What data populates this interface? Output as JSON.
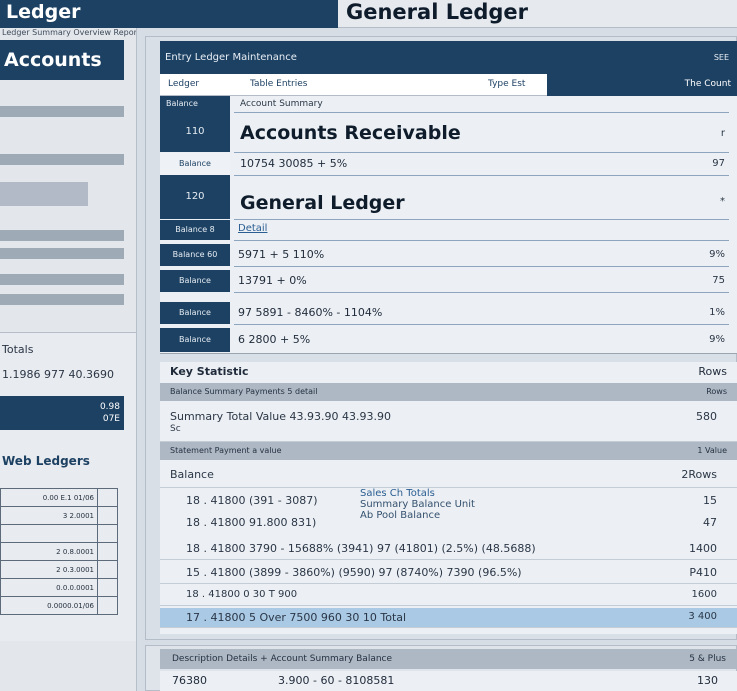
{
  "topbar": {
    "left_title": "Ledger",
    "right_title": "General Ledger"
  },
  "sidebar": {
    "caption": "Ledger Summary Overview Reports",
    "accounts_label": "Accounts"
  },
  "sidebar2": {
    "label_1": "Totals",
    "figures": "1.1986   977 40.3690",
    "dark_line_1": "0.98",
    "dark_line_2": "07E",
    "link": "Web Ledgers",
    "table_rows": [
      "0.00 E.1 01/06",
      "3 2.0001",
      "2 0.8.0001",
      "2 0.3.0001",
      "0.0.0.0001",
      "0.0000.01/06"
    ]
  },
  "main": {
    "header_title": "Entry Ledger Maintenance",
    "header_right": "SEE",
    "columns": {
      "c1": "Ledger",
      "c2": "Table Entries",
      "c3": "Type Est",
      "c4": "The Count"
    },
    "subheader_left": "Balance",
    "subheader_right": "Account Summary",
    "section1": {
      "code": "110",
      "title": "Accounts Receivable",
      "marker": "r"
    },
    "row1": {
      "label": "Balance",
      "amount": "10754 30085 + 5%",
      "right": "97"
    },
    "section2": {
      "code": "120",
      "title": "General Ledger",
      "marker": "*"
    },
    "row2": {
      "label": "Balance 8",
      "link": "Detail"
    },
    "row3": {
      "label": "Balance 60",
      "amount": "5971 + 5 110%",
      "right": "9%"
    },
    "row4": {
      "label": "Balance",
      "amount": "13791 + 0%",
      "right": "75"
    },
    "row5": {
      "label": "Balance",
      "amount": "97 5891 - 8460% - 1104%",
      "right": "1%"
    },
    "row6": {
      "label": "Balance",
      "amount": "6 2800 + 5%",
      "right": "9%"
    }
  },
  "transactions": {
    "title": "Key Statistic",
    "title_right": "Rows",
    "band1": {
      "left": "Balance Summary Payments 5 detail",
      "right": "Rows"
    },
    "summary_row": {
      "left": "Summary   Total   Value   43.93.90   43.93.90",
      "sub": "Sc",
      "right": "580"
    },
    "band2": {
      "left": "Statement Payment a value",
      "right": "1 Value"
    },
    "balance_row": {
      "left": "Balance",
      "right": "2Rows"
    },
    "rows": [
      {
        "left": "18 . 41800  (391 - 3087)",
        "right": "15"
      },
      {
        "left": "18 . 41800  91.800  831)",
        "right": "47"
      },
      {
        "left": "18 . 41800  3790  - 15688%  (3941) 97  (41801)  (2.5%)  (48.5688)",
        "right": "1400"
      },
      {
        "left": "15 . 41800  (3899 - 3860%)  (9590)  97  (8740%)  7390  (96.5%)",
        "right": "P410"
      },
      {
        "left": "18 . 41800  0 30  T 900",
        "right": "1600"
      },
      {
        "left": "17 . 41800  5 Over    7500   960   30   10   Total",
        "right": "3 400"
      }
    ],
    "annotation": {
      "line1": "Sales   Ch   Totals",
      "line2": "Summary Balance   Unit",
      "line3": "Ab   Pool   Balance"
    }
  },
  "bottom": {
    "band_left": "Description Details + Account   Summary Balance",
    "band_right": "5 & Plus",
    "row_left": "76380",
    "row_mid": "3.900 - 60 - 8108581",
    "row_right": "130"
  }
}
